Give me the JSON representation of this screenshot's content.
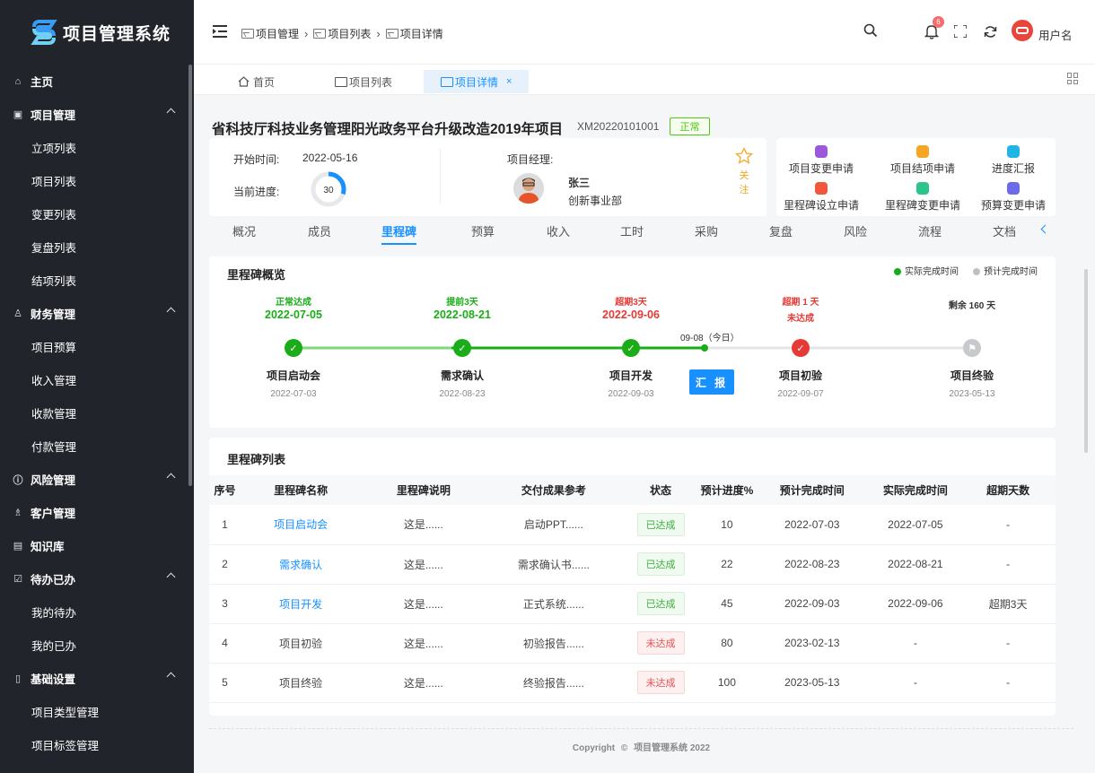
{
  "app": {
    "title": "项目管理系统"
  },
  "sidebar": {
    "items": [
      {
        "label": "主页",
        "level": "top",
        "icon": "home-icon"
      },
      {
        "label": "项目管理",
        "level": "top",
        "icon": "briefcase-icon",
        "expandable": true
      },
      {
        "label": "立项列表",
        "level": "sub"
      },
      {
        "label": "项目列表",
        "level": "sub"
      },
      {
        "label": "变更列表",
        "level": "sub"
      },
      {
        "label": "复盘列表",
        "level": "sub"
      },
      {
        "label": "结项列表",
        "level": "sub"
      },
      {
        "label": "财务管理",
        "level": "top",
        "icon": "user-icon",
        "expandable": true
      },
      {
        "label": "项目预算",
        "level": "sub"
      },
      {
        "label": "收入管理",
        "level": "sub"
      },
      {
        "label": "收款管理",
        "level": "sub"
      },
      {
        "label": "付款管理",
        "level": "sub"
      },
      {
        "label": "风险管理",
        "level": "top",
        "icon": "info-icon",
        "expandable": true
      },
      {
        "label": "客户管理",
        "level": "top",
        "icon": "customers-icon"
      },
      {
        "label": "知识库",
        "level": "top",
        "icon": "book-icon"
      },
      {
        "label": "待办已办",
        "level": "top",
        "icon": "checkbox-icon",
        "expandable": true
      },
      {
        "label": "我的待办",
        "level": "sub"
      },
      {
        "label": "我的已办",
        "level": "sub"
      },
      {
        "label": "基础设置",
        "level": "top",
        "icon": "settings-icon",
        "expandable": true
      },
      {
        "label": "项目类型管理",
        "level": "sub"
      },
      {
        "label": "项目标签管理",
        "level": "sub"
      }
    ]
  },
  "header": {
    "breadcrumb": [
      "项目管理",
      "项目列表",
      "项目详情"
    ],
    "notification_count": "6",
    "user_name": "用户名"
  },
  "tabs": [
    {
      "label": "首页"
    },
    {
      "label": "项目列表"
    },
    {
      "label": "项目详情",
      "close": "×"
    }
  ],
  "project": {
    "title": "省科技厅科技业务管理阳光政务平台升级改造2019年项目",
    "code": "XM20220101001",
    "status": "正常",
    "start_label": "开始时间:",
    "start_date": "2022-05-16",
    "progress_label": "当前进度:",
    "progress": 30,
    "manager_label": "项目经理:",
    "manager_name": "张三",
    "manager_dept": "创新事业部",
    "follow_label": "关注"
  },
  "actions": [
    {
      "label": "项目变更申请",
      "color": "#9b59d9"
    },
    {
      "label": "项目结项申请",
      "color": "#f5a623"
    },
    {
      "label": "进度汇报",
      "color": "#1fb6e6"
    },
    {
      "label": "里程碑设立申请",
      "color": "#f0573c"
    },
    {
      "label": "里程碑变更申请",
      "color": "#2bc48a"
    },
    {
      "label": "预算变更申请",
      "color": "#6b6bea"
    }
  ],
  "subnav": [
    "概况",
    "成员",
    "里程碑",
    "预算",
    "收入",
    "工时",
    "采购",
    "复盘",
    "风险",
    "流程",
    "文档"
  ],
  "overview": {
    "title": "里程碑概览",
    "legend_actual": "实际完成时间",
    "legend_plan": "预计完成时间",
    "today_label": "09-08（今日）",
    "report_button": "汇 报",
    "milestones": [
      {
        "status": "正常达成",
        "actual": "2022-07-05",
        "name": "项目启动会",
        "plan": "2022-07-03",
        "state": "done",
        "color": "#1aad19"
      },
      {
        "status": "提前3天",
        "actual": "2022-08-21",
        "name": "需求确认",
        "plan": "2022-08-23",
        "state": "done",
        "color": "#1aad19"
      },
      {
        "status": "超期3天",
        "actual": "2022-09-06",
        "name": "项目开发",
        "plan": "2022-09-03",
        "state": "done",
        "color": "#e53935"
      },
      {
        "status": "超期 1 天",
        "actual": "未达成",
        "name": "项目初验",
        "plan": "2022-09-07",
        "state": "late",
        "color": "#e53935"
      },
      {
        "status": "",
        "actual": "剩余 160 天",
        "name": "项目终验",
        "plan": "2023-05-13",
        "state": "pending",
        "color": "#333333"
      }
    ]
  },
  "list": {
    "title": "里程碑列表",
    "headers": [
      "序号",
      "里程碑名称",
      "里程碑说明",
      "交付成果参考",
      "状态",
      "预计进度%",
      "预计完成时间",
      "实际完成时间",
      "超期天数"
    ],
    "rows": [
      {
        "no": "1",
        "name": "项目启动会",
        "desc": "这是......",
        "deliverable": "启动PPT......",
        "status": "已达成",
        "ok": true,
        "progress": "10",
        "plan": "2022-07-03",
        "actual": "2022-07-05",
        "overdue": "-",
        "link": true
      },
      {
        "no": "2",
        "name": "需求确认",
        "desc": "这是......",
        "deliverable": "需求确认书......",
        "status": "已达成",
        "ok": true,
        "progress": "22",
        "plan": "2022-08-23",
        "actual": "2022-08-21",
        "overdue": "-",
        "link": true
      },
      {
        "no": "3",
        "name": "项目开发",
        "desc": "这是......",
        "deliverable": "正式系统......",
        "status": "已达成",
        "ok": true,
        "progress": "45",
        "plan": "2022-09-03",
        "actual": "2022-09-06",
        "overdue": "超期3天",
        "link": true
      },
      {
        "no": "4",
        "name": "项目初验",
        "desc": "这是......",
        "deliverable": "初验报告......",
        "status": "未达成",
        "ok": false,
        "progress": "80",
        "plan": "2023-02-13",
        "actual": "-",
        "overdue": "-",
        "link": false
      },
      {
        "no": "5",
        "name": "项目终验",
        "desc": "这是......",
        "deliverable": "终验报告......",
        "status": "未达成",
        "ok": false,
        "progress": "100",
        "plan": "2023-05-13",
        "actual": "-",
        "overdue": "-",
        "link": false
      }
    ]
  },
  "footer": {
    "copyright": "Copyright",
    "text": "项目管理系统 2022"
  }
}
